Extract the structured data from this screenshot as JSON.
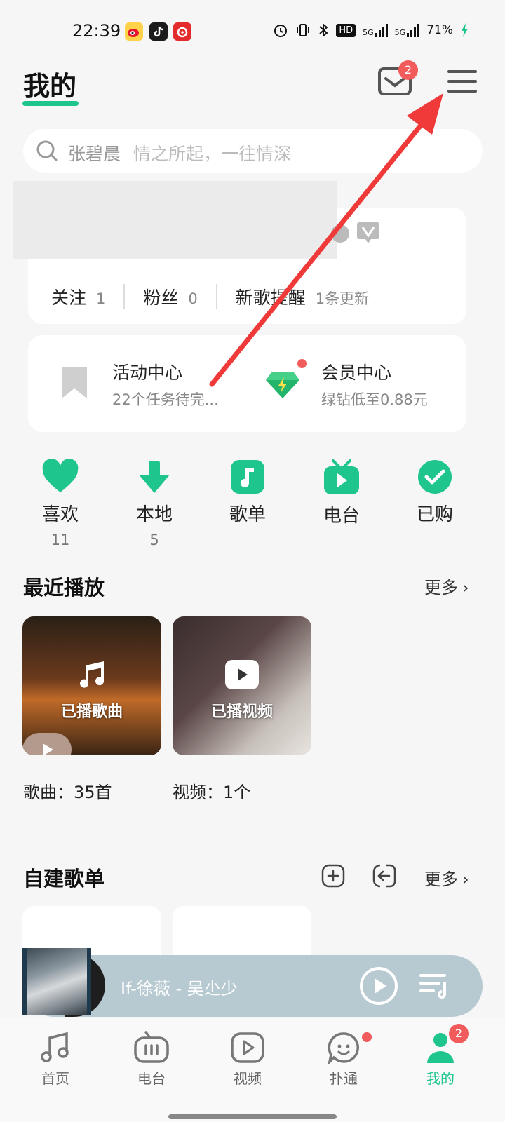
{
  "status": {
    "time": "22:39",
    "battery": "71%",
    "hd": "HD",
    "net1": "5G",
    "net2": "5G"
  },
  "header": {
    "title": "我的",
    "mail_badge": "2"
  },
  "search": {
    "keyword": "张碧晨",
    "hint": "情之所起，一往情深"
  },
  "profile": {
    "follow_label": "关注",
    "follow_count": "1",
    "fans_label": "粉丝",
    "fans_count": "0",
    "newsong_label": "新歌提醒",
    "newsong_count": "1条更新"
  },
  "activity": {
    "center_title": "活动中心",
    "center_sub": "22个任务待完...",
    "vip_title": "会员中心",
    "vip_sub": "绿钻低至0.88元"
  },
  "shortcuts": [
    {
      "label": "喜欢",
      "count": "11"
    },
    {
      "label": "本地",
      "count": "5"
    },
    {
      "label": "歌单",
      "count": ""
    },
    {
      "label": "电台",
      "count": ""
    },
    {
      "label": "已购",
      "count": ""
    }
  ],
  "recent": {
    "title": "最近播放",
    "more": "更多",
    "songs_label": "已播歌曲",
    "videos_label": "已播视频",
    "songs_caption": "歌曲：35首",
    "videos_caption": "视频：1个"
  },
  "playlists": {
    "title": "自建歌单",
    "more": "更多"
  },
  "player": {
    "song": "If-徐薇 - 吴尐少"
  },
  "tabs": [
    {
      "label": "首页"
    },
    {
      "label": "电台"
    },
    {
      "label": "视频"
    },
    {
      "label": "扑通"
    },
    {
      "label": "我的",
      "badge": "2"
    }
  ],
  "colors": {
    "accent": "#1ec58c",
    "badge": "#f15b5b",
    "arrow": "#f03a3a"
  }
}
